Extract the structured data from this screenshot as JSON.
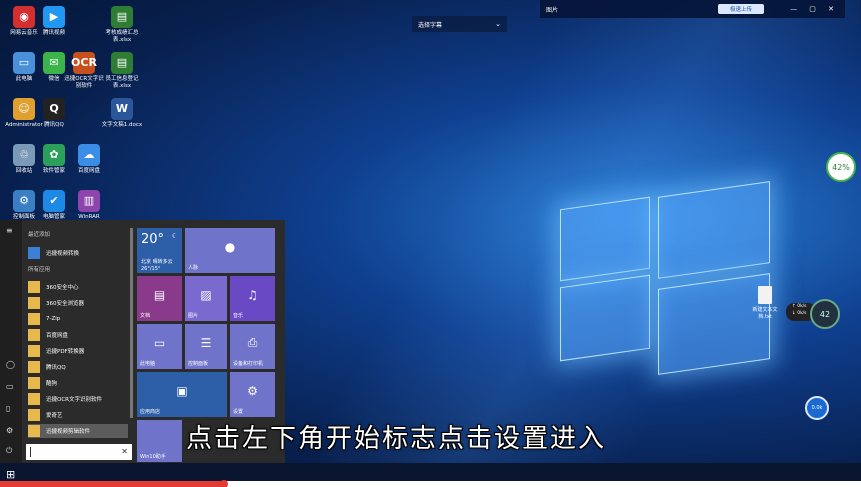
{
  "desktop": {
    "icons": [
      {
        "label": "网易云音乐",
        "glyph": "◉",
        "color": "#d32f2f"
      },
      {
        "label": "腾讯视频",
        "glyph": "▶",
        "color": "#2196f3"
      },
      {
        "label": "考核成绩汇总表.xlsx",
        "glyph": "▤",
        "color": "#2e7d32"
      },
      {
        "label": "此电脑",
        "glyph": "▭",
        "color": "#4a90d9"
      },
      {
        "label": "微信",
        "glyph": "✉",
        "color": "#3bb44a"
      },
      {
        "label": "迅捷OCR文字识别软件",
        "glyph": "OCR",
        "color": "#c8501c"
      },
      {
        "label": "员工信息登记表.xlsx",
        "glyph": "▤",
        "color": "#2e7d32"
      },
      {
        "label": "Administrator",
        "glyph": "☺",
        "color": "#e0a030"
      },
      {
        "label": "腾讯QQ",
        "glyph": "Q",
        "color": "#222"
      },
      {
        "label": "文字文稿1.docx",
        "glyph": "W",
        "color": "#2b579a"
      },
      {
        "label": "回收站",
        "glyph": "♲",
        "color": "#7a9ab8"
      },
      {
        "label": "软件管家",
        "glyph": "✿",
        "color": "#2aa05a"
      },
      {
        "label": "百度网盘",
        "glyph": "☁",
        "color": "#3a8ee6"
      },
      {
        "label": "控制面板",
        "glyph": "⚙",
        "color": "#3a7fc4"
      },
      {
        "label": "电脑管家",
        "glyph": "✔",
        "color": "#1e88e5"
      },
      {
        "label": "WinRAR",
        "glyph": "▥",
        "color": "#8e44ad"
      }
    ]
  },
  "topbar": {
    "dropdown_label": "选择字幕",
    "window_title": "图片",
    "action_button": "极速上传",
    "window_controls": "— ▢ ✕"
  },
  "widgets": {
    "gauge_top": "42%",
    "gauge_right": "42",
    "net_up": "↑ 0k/s",
    "net_down": "↓ 0k/s",
    "bubble": "0.0k",
    "doc_label": "新建文本文档.txt"
  },
  "start_menu": {
    "section_recent": "最近添加",
    "section_all": "所有应用",
    "recent_app": "迅捷视频转换",
    "apps": [
      "360安全中心",
      "360安全浏览器",
      "7-Zip",
      "百度网盘",
      "迅捷PDF转换器",
      "腾讯QQ",
      "酷狗",
      "迅捷OCR文字识别软件",
      "爱奇艺",
      "迅捷视频剪辑软件"
    ],
    "search_placeholder": "",
    "tiles": {
      "weather_temp": "20°",
      "weather_city": "北京 晴转多云",
      "weather_range": "26°/15°",
      "people": "人脉",
      "documents": "文档",
      "pictures": "图片",
      "music": "音乐",
      "pc": "此电脑",
      "control": "控制面板",
      "devices": "设备和打印机",
      "store": "应用商店",
      "settings": "设置",
      "edge": "Win10助手"
    }
  },
  "subtitle": "点击左下角开始标志点击设置进入",
  "video_progress": 0.26
}
